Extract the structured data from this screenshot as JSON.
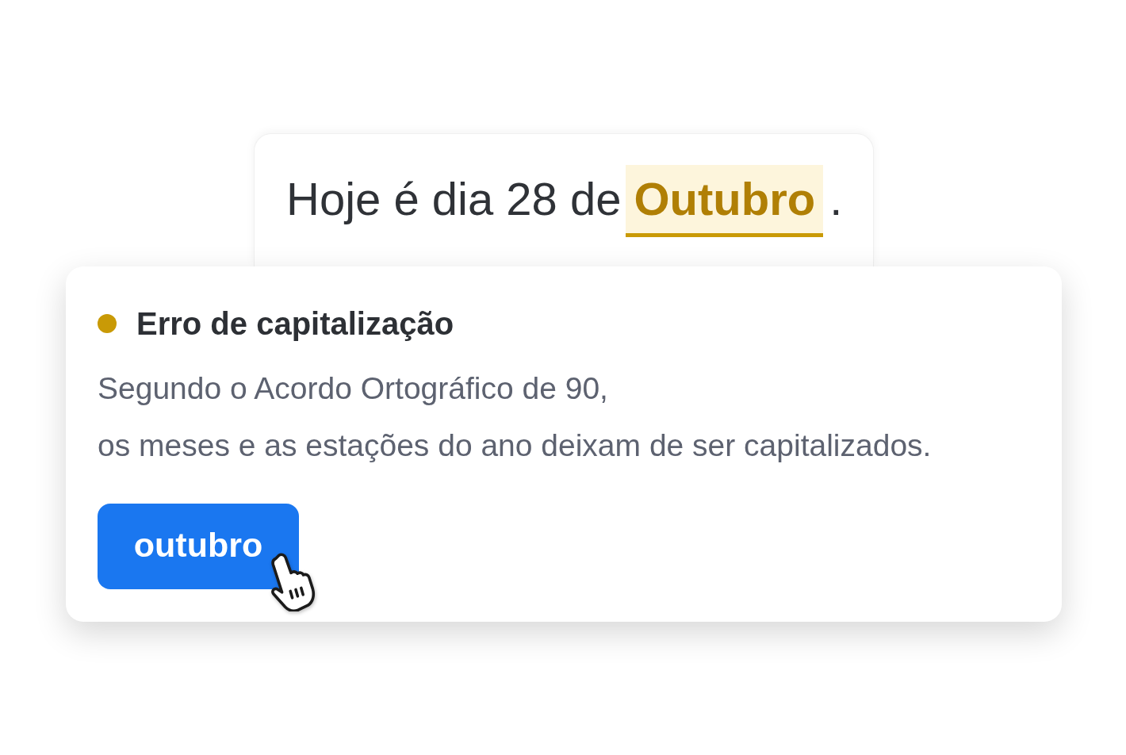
{
  "sentence": {
    "before": "Hoje é dia 28 de",
    "flagged_word": "Outubro",
    "after": "."
  },
  "suggestion": {
    "title": "Erro de capitalização",
    "description_lines": [
      "Segundo o Acordo Ortográfico de 90,",
      "os meses e as estações do ano deixam de ser capitalizados."
    ],
    "replacement": "outubro"
  }
}
